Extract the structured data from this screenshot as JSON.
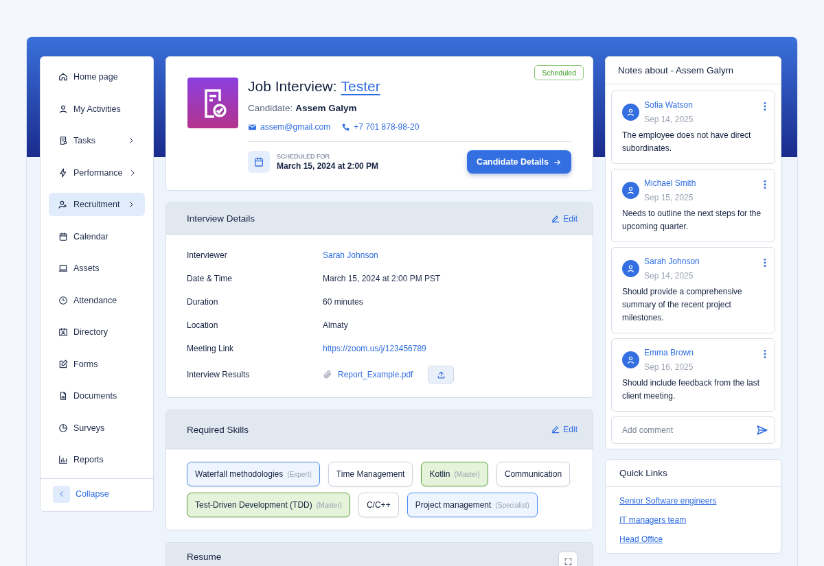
{
  "sidebar": {
    "items": [
      {
        "label": "Home page",
        "selected": false,
        "submenu": false
      },
      {
        "label": "My Activities",
        "selected": false,
        "submenu": false
      },
      {
        "label": "Tasks",
        "selected": false,
        "submenu": true
      },
      {
        "label": "Performance",
        "selected": false,
        "submenu": true
      },
      {
        "label": "Recruitment",
        "selected": true,
        "submenu": true
      },
      {
        "label": "Calendar",
        "selected": false,
        "submenu": false
      },
      {
        "label": "Assets",
        "selected": false,
        "submenu": false
      },
      {
        "label": "Attendance",
        "selected": false,
        "submenu": false
      },
      {
        "label": "Directory",
        "selected": false,
        "submenu": false
      },
      {
        "label": "Forms",
        "selected": false,
        "submenu": false
      },
      {
        "label": "Documents",
        "selected": false,
        "submenu": false
      },
      {
        "label": "Surveys",
        "selected": false,
        "submenu": false
      },
      {
        "label": "Reports",
        "selected": false,
        "submenu": false
      }
    ],
    "collapse": "Collapse"
  },
  "interview": {
    "status": "Scheduled",
    "title": "Job Interview:",
    "position": "Tester",
    "candidate_label": "Candidate:",
    "candidate": "Assem Galym",
    "email": "assem@gmail.com",
    "phone": "+7 701 878-98-20",
    "scheduled_label": "SCHEDULED FOR",
    "scheduled_at": "March 15, 2024 at 2:00 PM",
    "details_button": "Candidate Details"
  },
  "details": {
    "title": "Interview Details",
    "edit": "Edit",
    "rows": [
      {
        "label": "Interviewer",
        "value": "Sarah Johnson",
        "kind": "link"
      },
      {
        "label": "Date & Time",
        "value": "March 15, 2024 at 2:00 PM PST",
        "kind": "text"
      },
      {
        "label": "Duration",
        "value": "60 minutes",
        "kind": "text"
      },
      {
        "label": "Location",
        "value": "Almaty",
        "kind": "text"
      },
      {
        "label": "Meeting Link",
        "value": "https://zoom.us/j/123456789",
        "kind": "link"
      },
      {
        "label": "Interview Results",
        "value": "Report_Example.pdf",
        "kind": "file"
      }
    ]
  },
  "skills": {
    "title": "Required Skills",
    "edit": "Edit",
    "items": [
      {
        "name": "Waterfall methodologies",
        "level": "(Expert)",
        "color": "#4a8af0"
      },
      {
        "name": "Time Management"
      },
      {
        "name": "Kotlin",
        "level": "(Master)",
        "color": "#5aa132"
      },
      {
        "name": "Communication"
      },
      {
        "name": "Test-Driven Development (TDD)",
        "level": "(Master)",
        "color": "#5aa132"
      },
      {
        "name": "C/C++"
      },
      {
        "name": "Project management",
        "level": "(Specialist)",
        "color": "#4a8af0"
      }
    ]
  },
  "resume": {
    "title": "Resume"
  },
  "notes": {
    "title": "Notes about - Assem Galym",
    "items": [
      {
        "author": "Sofia Watson",
        "date": "Sep 14, 2025",
        "text": "The employee does not have direct subordinates."
      },
      {
        "author": "Michael Smith",
        "date": "Sep 15, 2025",
        "text": "Needs to outline the next steps for the upcoming quarter."
      },
      {
        "author": "Sarah Johnson",
        "date": "Sep 14, 2025",
        "text": "Should provide a comprehensive summary of the recent project milestones."
      },
      {
        "author": "Emma Brown",
        "date": "Sep 16, 2025",
        "text": "Should include feedback from the last client meeting."
      }
    ],
    "comment_placeholder": "Add comment"
  },
  "quick_links": {
    "title": "Quick Links",
    "items": [
      "Senior Software engineers",
      "IT managers team",
      "Head Office"
    ]
  }
}
